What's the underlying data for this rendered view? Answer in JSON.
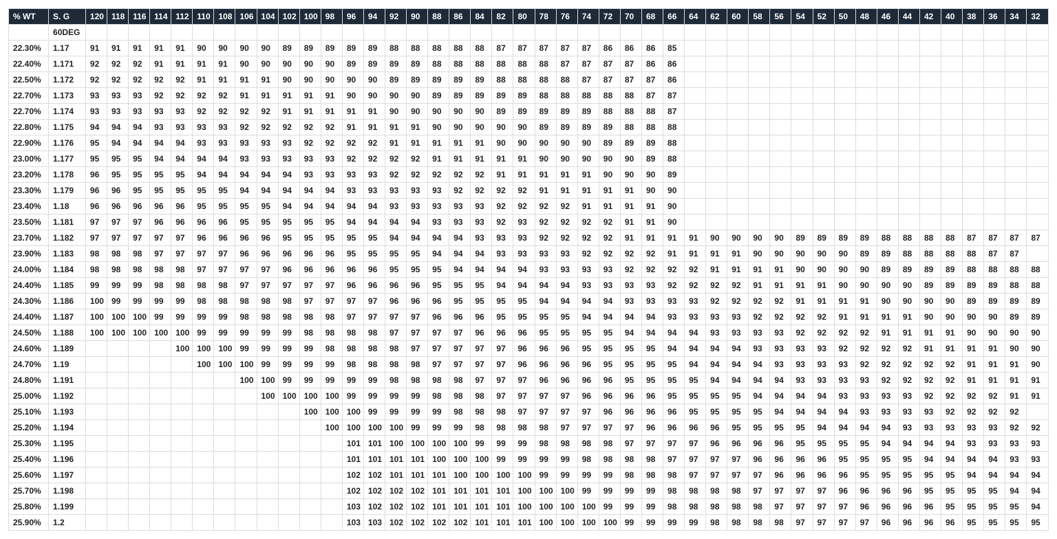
{
  "headers": [
    "% WT",
    "S. G",
    "120",
    "118",
    "116",
    "114",
    "112",
    "110",
    "108",
    "106",
    "104",
    "102",
    "100",
    "98",
    "96",
    "94",
    "92",
    "90",
    "88",
    "86",
    "84",
    "82",
    "80",
    "78",
    "76",
    "74",
    "72",
    "70",
    "68",
    "66",
    "64",
    "62",
    "60",
    "58",
    "56",
    "54",
    "52",
    "50",
    "48",
    "46",
    "44",
    "42",
    "40",
    "38",
    "36",
    "34",
    "32"
  ],
  "subheaderRow": [
    "",
    "60DEG"
  ],
  "rows": [
    [
      "22.30%",
      "1.17",
      "91",
      "91",
      "91",
      "91",
      "91",
      "90",
      "90",
      "90",
      "90",
      "89",
      "89",
      "89",
      "89",
      "89",
      "88",
      "88",
      "88",
      "88",
      "88",
      "87",
      "87",
      "87",
      "87",
      "87",
      "86",
      "86",
      "86",
      "85",
      "",
      "",
      "",
      "",
      "",
      "",
      "",
      "",
      "",
      "",
      "",
      "",
      "",
      "",
      "",
      "",
      ""
    ],
    [
      "22.40%",
      "1.171",
      "92",
      "92",
      "92",
      "91",
      "91",
      "91",
      "91",
      "90",
      "90",
      "90",
      "90",
      "90",
      "89",
      "89",
      "89",
      "89",
      "88",
      "88",
      "88",
      "88",
      "88",
      "88",
      "87",
      "87",
      "87",
      "87",
      "86",
      "86",
      "",
      "",
      "",
      "",
      "",
      "",
      "",
      "",
      "",
      "",
      "",
      "",
      "",
      "",
      "",
      "",
      ""
    ],
    [
      "22.50%",
      "1.172",
      "92",
      "92",
      "92",
      "92",
      "92",
      "91",
      "91",
      "91",
      "91",
      "90",
      "90",
      "90",
      "90",
      "90",
      "89",
      "89",
      "89",
      "89",
      "89",
      "88",
      "88",
      "88",
      "88",
      "87",
      "87",
      "87",
      "87",
      "86",
      "",
      "",
      "",
      "",
      "",
      "",
      "",
      "",
      "",
      "",
      "",
      "",
      "",
      "",
      "",
      "",
      ""
    ],
    [
      "22.70%",
      "1.173",
      "93",
      "93",
      "93",
      "92",
      "92",
      "92",
      "92",
      "91",
      "91",
      "91",
      "91",
      "91",
      "90",
      "90",
      "90",
      "90",
      "89",
      "89",
      "89",
      "89",
      "89",
      "88",
      "88",
      "88",
      "88",
      "88",
      "87",
      "87",
      "",
      "",
      "",
      "",
      "",
      "",
      "",
      "",
      "",
      "",
      "",
      "",
      "",
      "",
      "",
      "",
      ""
    ],
    [
      "22.70%",
      "1.174",
      "93",
      "93",
      "93",
      "93",
      "93",
      "92",
      "92",
      "92",
      "92",
      "91",
      "91",
      "91",
      "91",
      "91",
      "90",
      "90",
      "90",
      "90",
      "90",
      "89",
      "89",
      "89",
      "89",
      "89",
      "88",
      "88",
      "88",
      "87",
      "",
      "",
      "",
      "",
      "",
      "",
      "",
      "",
      "",
      "",
      "",
      "",
      "",
      "",
      "",
      "",
      ""
    ],
    [
      "22.80%",
      "1.175",
      "94",
      "94",
      "94",
      "93",
      "93",
      "93",
      "93",
      "92",
      "92",
      "92",
      "92",
      "92",
      "91",
      "91",
      "91",
      "91",
      "90",
      "90",
      "90",
      "90",
      "90",
      "89",
      "89",
      "89",
      "89",
      "88",
      "88",
      "88",
      "",
      "",
      "",
      "",
      "",
      "",
      "",
      "",
      "",
      "",
      "",
      "",
      "",
      "",
      "",
      "",
      ""
    ],
    [
      "22.90%",
      "1.176",
      "95",
      "94",
      "94",
      "94",
      "94",
      "93",
      "93",
      "93",
      "93",
      "93",
      "92",
      "92",
      "92",
      "92",
      "91",
      "91",
      "91",
      "91",
      "91",
      "90",
      "90",
      "90",
      "90",
      "90",
      "89",
      "89",
      "89",
      "88",
      "",
      "",
      "",
      "",
      "",
      "",
      "",
      "",
      "",
      "",
      "",
      "",
      "",
      "",
      "",
      "",
      ""
    ],
    [
      "23.00%",
      "1.177",
      "95",
      "95",
      "95",
      "94",
      "94",
      "94",
      "94",
      "93",
      "93",
      "93",
      "93",
      "93",
      "92",
      "92",
      "92",
      "92",
      "91",
      "91",
      "91",
      "91",
      "91",
      "90",
      "90",
      "90",
      "90",
      "90",
      "89",
      "88",
      "",
      "",
      "",
      "",
      "",
      "",
      "",
      "",
      "",
      "",
      "",
      "",
      "",
      "",
      "",
      "",
      ""
    ],
    [
      "23.20%",
      "1.178",
      "96",
      "95",
      "95",
      "95",
      "95",
      "94",
      "94",
      "94",
      "94",
      "94",
      "93",
      "93",
      "93",
      "93",
      "92",
      "92",
      "92",
      "92",
      "92",
      "91",
      "91",
      "91",
      "91",
      "91",
      "90",
      "90",
      "90",
      "89",
      "",
      "",
      "",
      "",
      "",
      "",
      "",
      "",
      "",
      "",
      "",
      "",
      "",
      "",
      "",
      "",
      ""
    ],
    [
      "23.30%",
      "1.179",
      "96",
      "96",
      "95",
      "95",
      "95",
      "95",
      "95",
      "94",
      "94",
      "94",
      "94",
      "94",
      "93",
      "93",
      "93",
      "93",
      "93",
      "92",
      "92",
      "92",
      "92",
      "91",
      "91",
      "91",
      "91",
      "91",
      "90",
      "90",
      "",
      "",
      "",
      "",
      "",
      "",
      "",
      "",
      "",
      "",
      "",
      "",
      "",
      "",
      "",
      "",
      ""
    ],
    [
      "23.40%",
      "1.18",
      "96",
      "96",
      "96",
      "96",
      "96",
      "95",
      "95",
      "95",
      "95",
      "94",
      "94",
      "94",
      "94",
      "94",
      "93",
      "93",
      "93",
      "93",
      "93",
      "92",
      "92",
      "92",
      "92",
      "91",
      "91",
      "91",
      "91",
      "90",
      "",
      "",
      "",
      "",
      "",
      "",
      "",
      "",
      "",
      "",
      "",
      "",
      "",
      "",
      "",
      "",
      ""
    ],
    [
      "23.50%",
      "1.181",
      "97",
      "97",
      "97",
      "96",
      "96",
      "96",
      "96",
      "95",
      "95",
      "95",
      "95",
      "95",
      "94",
      "94",
      "94",
      "94",
      "93",
      "93",
      "93",
      "92",
      "93",
      "92",
      "92",
      "92",
      "92",
      "91",
      "91",
      "90",
      "",
      "",
      "",
      "",
      "",
      "",
      "",
      "",
      "",
      "",
      "",
      "",
      "",
      "",
      "",
      "",
      ""
    ],
    [
      "23.70%",
      "1.182",
      "97",
      "97",
      "97",
      "97",
      "97",
      "96",
      "96",
      "96",
      "96",
      "95",
      "95",
      "95",
      "95",
      "95",
      "94",
      "94",
      "94",
      "94",
      "93",
      "93",
      "93",
      "92",
      "92",
      "92",
      "92",
      "91",
      "91",
      "91",
      "91",
      "90",
      "90",
      "90",
      "90",
      "89",
      "89",
      "89",
      "89",
      "88",
      "88",
      "88",
      "88",
      "87",
      "87",
      "87",
      "87"
    ],
    [
      "23.90%",
      "1.183",
      "98",
      "98",
      "98",
      "97",
      "97",
      "97",
      "97",
      "96",
      "96",
      "96",
      "96",
      "96",
      "95",
      "95",
      "95",
      "95",
      "94",
      "94",
      "94",
      "93",
      "93",
      "93",
      "93",
      "92",
      "92",
      "92",
      "92",
      "91",
      "91",
      "91",
      "91",
      "90",
      "90",
      "90",
      "90",
      "90",
      "89",
      "89",
      "88",
      "88",
      "88",
      "88",
      "87",
      "87"
    ],
    [
      "24.00%",
      "1.184",
      "98",
      "98",
      "98",
      "98",
      "98",
      "97",
      "97",
      "97",
      "97",
      "96",
      "96",
      "96",
      "96",
      "96",
      "95",
      "95",
      "95",
      "94",
      "94",
      "94",
      "94",
      "93",
      "93",
      "93",
      "93",
      "92",
      "92",
      "92",
      "92",
      "91",
      "91",
      "91",
      "91",
      "90",
      "90",
      "90",
      "90",
      "89",
      "89",
      "89",
      "89",
      "88",
      "88",
      "88",
      "88"
    ],
    [
      "24.40%",
      "1.185",
      "99",
      "99",
      "99",
      "98",
      "98",
      "98",
      "98",
      "97",
      "97",
      "97",
      "97",
      "97",
      "96",
      "96",
      "96",
      "96",
      "95",
      "95",
      "95",
      "94",
      "94",
      "94",
      "94",
      "93",
      "93",
      "93",
      "93",
      "92",
      "92",
      "92",
      "92",
      "91",
      "91",
      "91",
      "91",
      "90",
      "90",
      "90",
      "90",
      "89",
      "89",
      "89",
      "89",
      "88",
      "88"
    ],
    [
      "24.30%",
      "1.186",
      "100",
      "99",
      "99",
      "99",
      "99",
      "98",
      "98",
      "98",
      "98",
      "98",
      "97",
      "97",
      "97",
      "97",
      "96",
      "96",
      "96",
      "95",
      "95",
      "95",
      "95",
      "94",
      "94",
      "94",
      "94",
      "93",
      "93",
      "93",
      "93",
      "92",
      "92",
      "92",
      "92",
      "91",
      "91",
      "91",
      "91",
      "90",
      "90",
      "90",
      "90",
      "89",
      "89",
      "89",
      "89"
    ],
    [
      "24.40%",
      "1.187",
      "100",
      "100",
      "100",
      "99",
      "99",
      "99",
      "99",
      "98",
      "98",
      "98",
      "98",
      "98",
      "97",
      "97",
      "97",
      "97",
      "96",
      "96",
      "96",
      "95",
      "95",
      "95",
      "95",
      "94",
      "94",
      "94",
      "94",
      "93",
      "93",
      "93",
      "93",
      "92",
      "92",
      "92",
      "92",
      "91",
      "91",
      "91",
      "91",
      "90",
      "90",
      "90",
      "90",
      "89",
      "89"
    ],
    [
      "24.50%",
      "1.188",
      "100",
      "100",
      "100",
      "100",
      "100",
      "99",
      "99",
      "99",
      "99",
      "99",
      "98",
      "98",
      "98",
      "98",
      "97",
      "97",
      "97",
      "97",
      "96",
      "96",
      "96",
      "95",
      "95",
      "95",
      "95",
      "94",
      "94",
      "94",
      "94",
      "93",
      "93",
      "93",
      "93",
      "92",
      "92",
      "92",
      "92",
      "91",
      "91",
      "91",
      "91",
      "90",
      "90",
      "90",
      "90"
    ],
    [
      "24.60%",
      "1.189",
      "",
      "",
      "",
      "",
      "100",
      "100",
      "100",
      "99",
      "99",
      "99",
      "99",
      "98",
      "98",
      "98",
      "98",
      "97",
      "97",
      "97",
      "97",
      "97",
      "96",
      "96",
      "96",
      "95",
      "95",
      "95",
      "95",
      "94",
      "94",
      "94",
      "94",
      "93",
      "93",
      "93",
      "93",
      "92",
      "92",
      "92",
      "92",
      "91",
      "91",
      "91",
      "91",
      "90",
      "90",
      "90"
    ],
    [
      "24.70%",
      "1.19",
      "",
      "",
      "",
      "",
      "",
      "100",
      "100",
      "100",
      "99",
      "99",
      "99",
      "99",
      "98",
      "98",
      "98",
      "98",
      "97",
      "97",
      "97",
      "97",
      "96",
      "96",
      "96",
      "96",
      "95",
      "95",
      "95",
      "95",
      "94",
      "94",
      "94",
      "94",
      "93",
      "93",
      "93",
      "93",
      "92",
      "92",
      "92",
      "92",
      "92",
      "91",
      "91",
      "91",
      "90"
    ],
    [
      "24.80%",
      "1.191",
      "",
      "",
      "",
      "",
      "",
      "",
      "",
      "100",
      "100",
      "99",
      "99",
      "99",
      "99",
      "99",
      "98",
      "98",
      "98",
      "98",
      "97",
      "97",
      "97",
      "96",
      "96",
      "96",
      "96",
      "95",
      "95",
      "95",
      "95",
      "94",
      "94",
      "94",
      "94",
      "93",
      "93",
      "93",
      "93",
      "92",
      "92",
      "92",
      "92",
      "91",
      "91",
      "91",
      "91"
    ],
    [
      "25.00%",
      "1.192",
      "",
      "",
      "",
      "",
      "",
      "",
      "",
      "",
      "100",
      "100",
      "100",
      "100",
      "99",
      "99",
      "99",
      "99",
      "98",
      "98",
      "98",
      "97",
      "97",
      "97",
      "97",
      "96",
      "96",
      "96",
      "96",
      "95",
      "95",
      "95",
      "95",
      "94",
      "94",
      "94",
      "94",
      "93",
      "93",
      "93",
      "93",
      "92",
      "92",
      "92",
      "92",
      "91",
      "91"
    ],
    [
      "25.10%",
      "1.193",
      "",
      "",
      "",
      "",
      "",
      "",
      "",
      "",
      "",
      "",
      "100",
      "100",
      "100",
      "99",
      "99",
      "99",
      "99",
      "98",
      "98",
      "98",
      "97",
      "97",
      "97",
      "97",
      "96",
      "96",
      "96",
      "96",
      "95",
      "95",
      "95",
      "95",
      "94",
      "94",
      "94",
      "94",
      "93",
      "93",
      "93",
      "93",
      "92",
      "92",
      "92",
      "92"
    ],
    [
      "25.20%",
      "1.194",
      "",
      "",
      "",
      "",
      "",
      "",
      "",
      "",
      "",
      "",
      "",
      "100",
      "100",
      "100",
      "100",
      "99",
      "99",
      "99",
      "98",
      "98",
      "98",
      "98",
      "97",
      "97",
      "97",
      "97",
      "96",
      "96",
      "96",
      "96",
      "95",
      "95",
      "95",
      "95",
      "94",
      "94",
      "94",
      "94",
      "93",
      "93",
      "93",
      "93",
      "93",
      "92",
      "92"
    ],
    [
      "25.30%",
      "1.195",
      "",
      "",
      "",
      "",
      "",
      "",
      "",
      "",
      "",
      "",
      "",
      "",
      "101",
      "101",
      "100",
      "100",
      "100",
      "100",
      "99",
      "99",
      "99",
      "98",
      "98",
      "98",
      "98",
      "97",
      "97",
      "97",
      "97",
      "96",
      "96",
      "96",
      "96",
      "95",
      "95",
      "95",
      "95",
      "94",
      "94",
      "94",
      "94",
      "93",
      "93",
      "93",
      "93"
    ],
    [
      "25.40%",
      "1.196",
      "",
      "",
      "",
      "",
      "",
      "",
      "",
      "",
      "",
      "",
      "",
      "",
      "101",
      "101",
      "101",
      "101",
      "100",
      "100",
      "100",
      "99",
      "99",
      "99",
      "99",
      "98",
      "98",
      "98",
      "98",
      "97",
      "97",
      "97",
      "97",
      "96",
      "96",
      "96",
      "96",
      "95",
      "95",
      "95",
      "95",
      "94",
      "94",
      "94",
      "94",
      "93",
      "93"
    ],
    [
      "25.60%",
      "1.197",
      "",
      "",
      "",
      "",
      "",
      "",
      "",
      "",
      "",
      "",
      "",
      "",
      "102",
      "102",
      "101",
      "101",
      "101",
      "100",
      "100",
      "100",
      "100",
      "99",
      "99",
      "99",
      "99",
      "98",
      "98",
      "98",
      "97",
      "97",
      "97",
      "97",
      "96",
      "96",
      "96",
      "96",
      "95",
      "95",
      "95",
      "95",
      "95",
      "94",
      "94",
      "94",
      "94"
    ],
    [
      "25.70%",
      "1.198",
      "",
      "",
      "",
      "",
      "",
      "",
      "",
      "",
      "",
      "",
      "",
      "",
      "102",
      "102",
      "102",
      "102",
      "101",
      "101",
      "101",
      "101",
      "100",
      "100",
      "100",
      "99",
      "99",
      "99",
      "99",
      "98",
      "98",
      "98",
      "98",
      "97",
      "97",
      "97",
      "97",
      "96",
      "96",
      "96",
      "96",
      "95",
      "95",
      "95",
      "95",
      "94",
      "94"
    ],
    [
      "25.80%",
      "1.199",
      "",
      "",
      "",
      "",
      "",
      "",
      "",
      "",
      "",
      "",
      "",
      "",
      "103",
      "102",
      "102",
      "102",
      "101",
      "101",
      "101",
      "101",
      "100",
      "100",
      "100",
      "100",
      "99",
      "99",
      "99",
      "98",
      "98",
      "98",
      "98",
      "98",
      "97",
      "97",
      "97",
      "97",
      "96",
      "96",
      "96",
      "96",
      "95",
      "95",
      "95",
      "95",
      "94"
    ],
    [
      "25.90%",
      "1.2",
      "",
      "",
      "",
      "",
      "",
      "",
      "",
      "",
      "",
      "",
      "",
      "",
      "103",
      "103",
      "102",
      "102",
      "102",
      "102",
      "101",
      "101",
      "101",
      "100",
      "100",
      "100",
      "100",
      "99",
      "99",
      "99",
      "99",
      "98",
      "98",
      "98",
      "98",
      "97",
      "97",
      "97",
      "97",
      "96",
      "96",
      "96",
      "96",
      "95",
      "95",
      "95",
      "95"
    ]
  ]
}
